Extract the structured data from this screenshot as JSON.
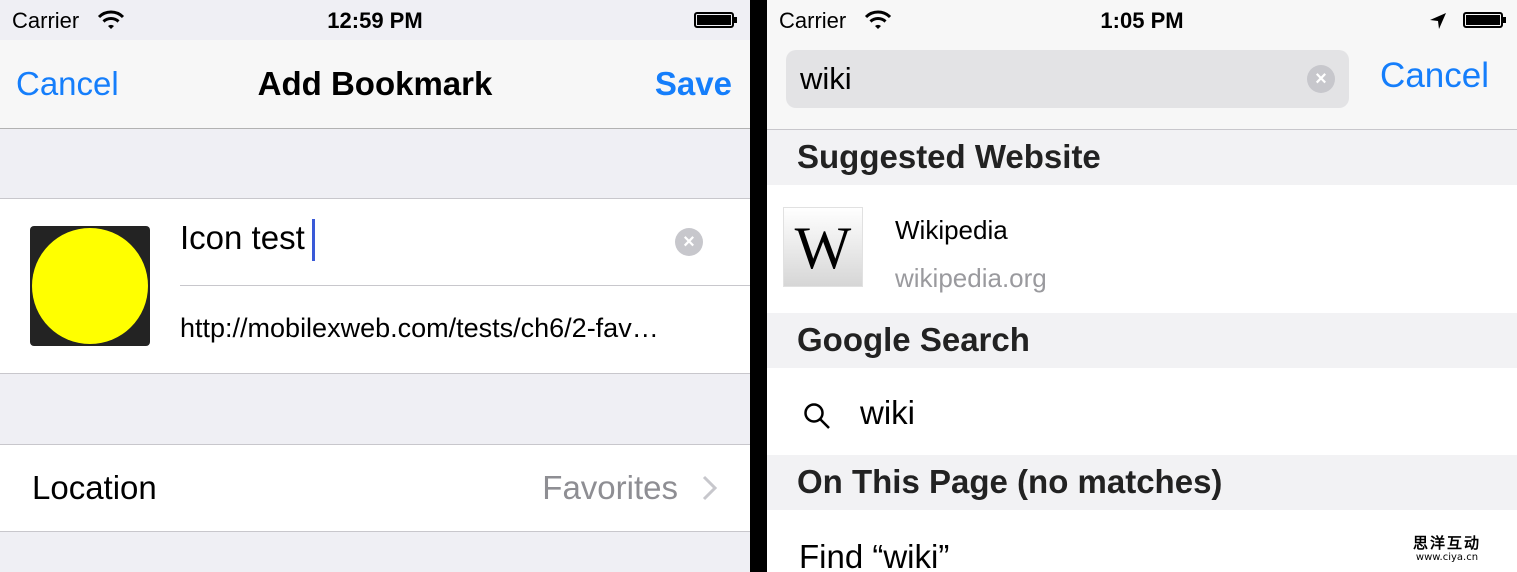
{
  "left": {
    "status": {
      "carrier": "Carrier",
      "time": "12:59 PM"
    },
    "nav": {
      "cancel": "Cancel",
      "title": "Add Bookmark",
      "save": "Save"
    },
    "bookmark": {
      "title_value": "Icon test",
      "url_value": "http://mobilexweb.com/tests/ch6/2-fav…",
      "icon_color": "#ffff00"
    },
    "location": {
      "label": "Location",
      "value": "Favorites"
    }
  },
  "right": {
    "status": {
      "carrier": "Carrier",
      "time": "1:05 PM"
    },
    "search": {
      "value": "wiki",
      "cancel": "Cancel"
    },
    "sections": {
      "suggested": "Suggested Website",
      "google": "Google Search",
      "on_page": "On This Page (no matches)"
    },
    "suggested_site": {
      "logo_letter": "W",
      "name": "Wikipedia",
      "domain": "wikipedia.org"
    },
    "google_row": {
      "query": "wiki"
    },
    "find_row": {
      "label": "Find “wiki”"
    }
  },
  "watermark": {
    "line1": "思洋互动",
    "line2": "www.ciya.cn"
  },
  "colors": {
    "accent": "#157efb",
    "secondary_text": "#8e8e93",
    "group_bg": "#efeff4"
  }
}
